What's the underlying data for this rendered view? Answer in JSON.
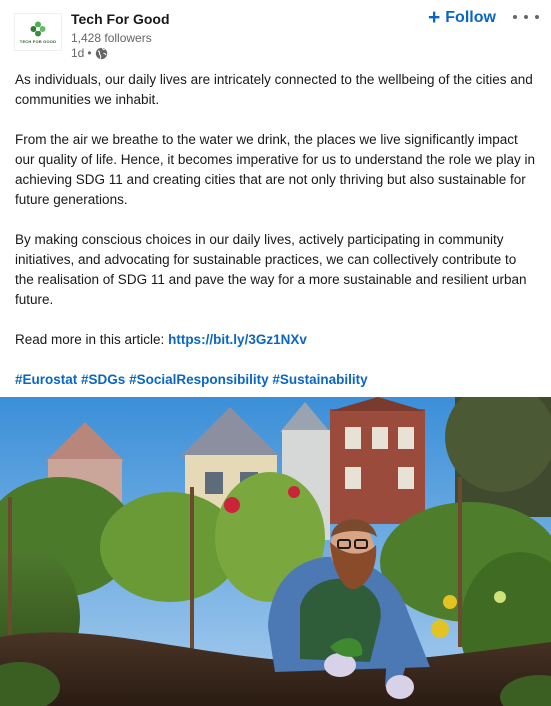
{
  "author": {
    "name": "Tech For Good",
    "followers": "1,428 followers",
    "time": "1d",
    "visibility_icon": "globe-icon",
    "logo_text": "TECH FOR GOOD"
  },
  "actions": {
    "follow_label": "Follow",
    "follow_icon": "plus-icon",
    "more_icon": "more-horizontal-icon"
  },
  "post": {
    "paragraphs": [
      "As individuals, our daily lives are intricately connected to the wellbeing of the cities and communities we inhabit.",
      "From the air we breathe to the water we drink, the places we live significantly impact our quality of life. Hence, it becomes imperative for us to understand the role we play in achieving SDG 11 and creating cities that are not only thriving but also sustainable for future generations.",
      "By making conscious choices in our daily lives, actively participating in community initiatives, and advocating for sustainable practices, we can collectively contribute to the realisation of SDG 11 and pave the way for a more sustainable and resilient urban future."
    ],
    "read_more_prefix": "Read more in this article:",
    "link": "https://bit.ly/3Gz1NXv",
    "hashtags": [
      "#Eurostat",
      "#SDGs",
      "#SocialResponsibility",
      "#Sustainability"
    ]
  },
  "colors": {
    "link": "#0a66c2",
    "text": "#191919",
    "secondary": "#666666"
  }
}
